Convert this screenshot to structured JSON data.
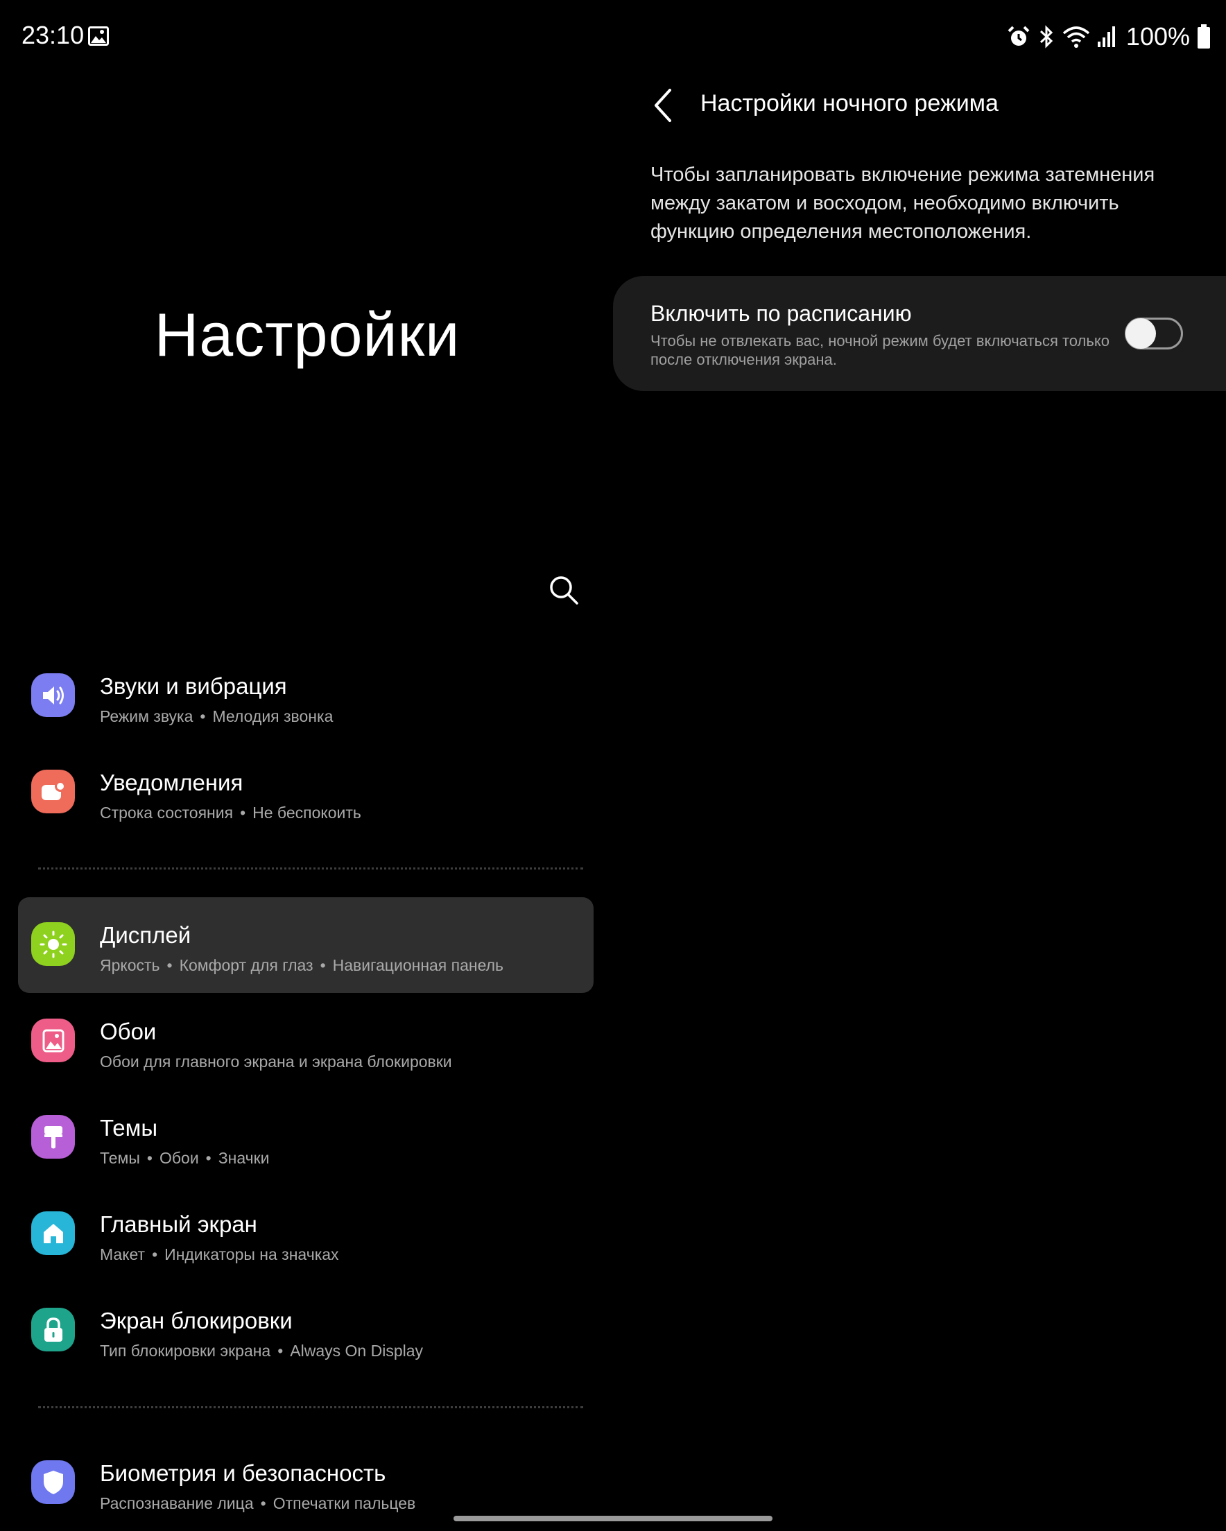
{
  "status_bar": {
    "time": "23:10",
    "icons": [
      "gallery-icon",
      "alarm-icon",
      "bluetooth-icon",
      "wifi-icon",
      "signal-icon",
      "battery-icon"
    ],
    "battery": "100%"
  },
  "left": {
    "title": "Настройки",
    "search_icon": "search-icon",
    "items": [
      {
        "title": "Звуки и вибрация",
        "sub": [
          "Режим звука",
          "Мелодия звонка"
        ],
        "icon": "volume-icon",
        "color": "#7d7df2"
      },
      {
        "title": "Уведомления",
        "sub": [
          "Строка состояния",
          "Не беспокоить"
        ],
        "icon": "notification-icon",
        "color": "#ef6b5a"
      },
      {
        "title": "Дисплей",
        "sub": [
          "Яркость",
          "Комфорт для глаз",
          "Навигационная панель"
        ],
        "icon": "brightness-icon",
        "color": "#8fd11f",
        "selected": true
      },
      {
        "title": "Обои",
        "sub": [
          "Обои для главного экрана и экрана блокировки"
        ],
        "icon": "wallpaper-icon",
        "color": "#ed5d88"
      },
      {
        "title": "Темы",
        "sub": [
          "Темы",
          "Обои",
          "Значки"
        ],
        "icon": "theme-brush-icon",
        "color": "#b75fd6"
      },
      {
        "title": "Главный экран",
        "sub": [
          "Макет",
          "Индикаторы на значках"
        ],
        "icon": "home-icon",
        "color": "#27b6d8"
      },
      {
        "title": "Экран блокировки",
        "sub": [
          "Тип блокировки экрана",
          "Always On Display"
        ],
        "icon": "lock-icon",
        "color": "#1fa48c"
      },
      {
        "title": "Биометрия и безопасность",
        "sub": [
          "Распознавание лица",
          "Отпечатки пальцев"
        ],
        "icon": "shield-icon",
        "color": "#6f78ef"
      }
    ]
  },
  "right": {
    "title": "Настройки ночного режима",
    "description": "Чтобы запланировать включение режима затемнения между закатом и восходом, необходимо включить функцию определения местоположения.",
    "schedule": {
      "title": "Включить по расписанию",
      "description": "Чтобы не отвлекать вас, ночной режим будет включаться только после отключения экрана.",
      "enabled": false
    }
  }
}
